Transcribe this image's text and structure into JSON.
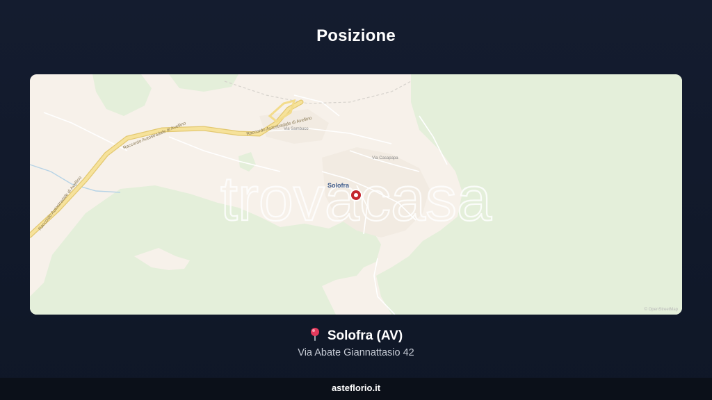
{
  "header": {
    "title": "Posizione"
  },
  "map": {
    "watermark": "trovacasa",
    "town_label": "Solofra",
    "road_labels": {
      "raccordo_east": "Raccordo Autostradale di Avellino",
      "raccordo_mid": "Raccordo Autostradale di Avellino",
      "raccordo_west": "Raccordo Autostradale di Avellino",
      "via_sambuco": "Via Sambuco",
      "via_casapapa": "Via Casapapa"
    },
    "attribution": "© OpenStreetMap",
    "marker_icon": "map-marker-icon",
    "colors": {
      "land": "#f7f1ea",
      "forest": "#e4efda",
      "highway": "#f3dc8c",
      "marker": "#c4262e"
    }
  },
  "location": {
    "pin_icon": "round-pushpin-icon",
    "name": "Solofra (AV)",
    "address": "Via Abate Giannattasio 42"
  },
  "footer": {
    "site": "asteflorio.it"
  }
}
